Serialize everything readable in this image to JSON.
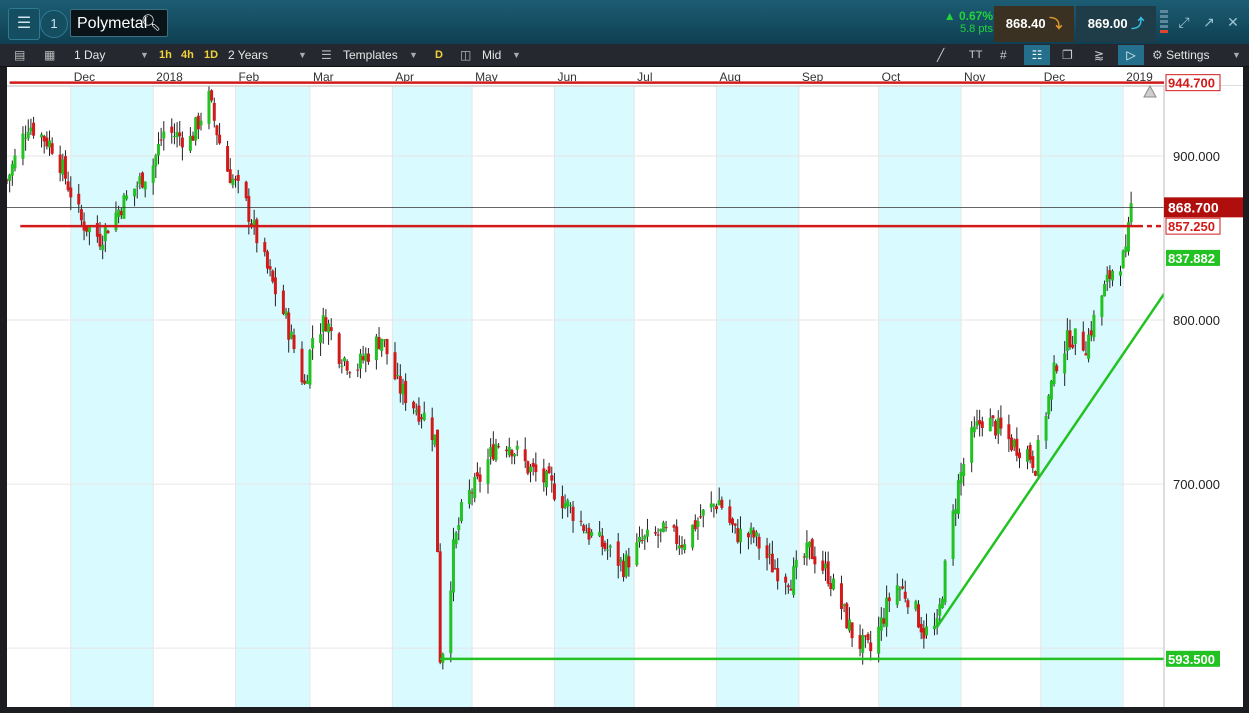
{
  "topbar": {
    "menu_icon": "hamburger-menu-icon",
    "info_label": "1",
    "symbol": "Polymetal",
    "change_pct": "▲ 0.67%",
    "change_pts": "5.8 pts",
    "sell_price": "868.40",
    "buy_price": "869.00"
  },
  "toolbar": {
    "interval": "1 Day",
    "quick_intervals": [
      "1h",
      "4h",
      "1D"
    ],
    "range": "2 Years",
    "templates": "Templates",
    "d_badge": "D",
    "price_type": "Mid",
    "tt_label": "TT",
    "settings": "Settings"
  },
  "colors": {
    "up": "#22c222",
    "down": "#d11b1b",
    "shade": "#d9fbff",
    "topbar": "#14536a"
  },
  "chart_data": {
    "type": "candlestick",
    "x_axis_labels": [
      "Dec",
      "2018",
      "Feb",
      "Mar",
      "Apr",
      "May",
      "Jun",
      "Jul",
      "Aug",
      "Sep",
      "Oct",
      "Nov",
      "Dec",
      "2019"
    ],
    "y_axis_ticks": [
      "900.000",
      "800.000",
      "700.000"
    ],
    "ylim": [
      565,
      970
    ],
    "grid": true,
    "horizontal_lines": [
      {
        "label": "944.700",
        "value": 944.7,
        "color": "#d11b1b"
      },
      {
        "label": "857.250",
        "value": 857.25,
        "color": "#d11b1b"
      },
      {
        "label": "593.500",
        "value": 593.5,
        "color": "#22c222"
      }
    ],
    "last_price": {
      "label": "868.700",
      "value": 868.7
    },
    "trendline": {
      "label": "837.882",
      "from": {
        "date": "2018-10-23",
        "value": 613
      },
      "to": {
        "date": "2019-01-04",
        "value": 837.882
      },
      "color": "#22c222"
    },
    "close_path": [
      [
        "2017-11-07",
        885
      ],
      [
        "2017-11-15",
        920
      ],
      [
        "2017-11-25",
        905
      ],
      [
        "2017-12-05",
        860
      ],
      [
        "2017-12-12",
        850
      ],
      [
        "2017-12-20",
        870
      ],
      [
        "2018-01-01",
        895
      ],
      [
        "2018-01-05",
        915
      ],
      [
        "2018-01-15",
        910
      ],
      [
        "2018-01-22",
        935
      ],
      [
        "2018-01-28",
        895
      ],
      [
        "2018-02-05",
        870
      ],
      [
        "2018-02-12",
        835
      ],
      [
        "2018-02-20",
        800
      ],
      [
        "2018-02-27",
        760
      ],
      [
        "2018-03-02",
        790
      ],
      [
        "2018-03-07",
        800
      ],
      [
        "2018-03-12",
        780
      ],
      [
        "2018-03-18",
        770
      ],
      [
        "2018-03-23",
        780
      ],
      [
        "2018-03-28",
        790
      ],
      [
        "2018-04-03",
        760
      ],
      [
        "2018-04-08",
        750
      ],
      [
        "2018-04-14",
        740
      ],
      [
        "2018-04-17",
        728
      ],
      [
        "2018-04-19",
        595
      ],
      [
        "2018-04-21",
        605
      ],
      [
        "2018-04-24",
        660
      ],
      [
        "2018-04-28",
        690
      ],
      [
        "2018-05-03",
        700
      ],
      [
        "2018-05-10",
        725
      ],
      [
        "2018-05-15",
        725
      ],
      [
        "2018-05-22",
        710
      ],
      [
        "2018-05-30",
        700
      ],
      [
        "2018-06-07",
        685
      ],
      [
        "2018-06-14",
        670
      ],
      [
        "2018-06-21",
        660
      ],
      [
        "2018-06-27",
        650
      ],
      [
        "2018-07-04",
        665
      ],
      [
        "2018-07-12",
        670
      ],
      [
        "2018-07-19",
        665
      ],
      [
        "2018-07-26",
        680
      ],
      [
        "2018-08-02",
        690
      ],
      [
        "2018-08-08",
        670
      ],
      [
        "2018-08-15",
        668
      ],
      [
        "2018-08-22",
        650
      ],
      [
        "2018-08-29",
        642
      ],
      [
        "2018-09-05",
        660
      ],
      [
        "2018-09-12",
        645
      ],
      [
        "2018-09-17",
        625
      ],
      [
        "2018-09-22",
        605
      ],
      [
        "2018-09-28",
        598
      ],
      [
        "2018-10-03",
        620
      ],
      [
        "2018-10-07",
        640
      ],
      [
        "2018-10-13",
        630
      ],
      [
        "2018-10-18",
        610
      ],
      [
        "2018-10-23",
        612
      ],
      [
        "2018-10-27",
        660
      ],
      [
        "2018-10-31",
        700
      ],
      [
        "2018-11-04",
        725
      ],
      [
        "2018-11-09",
        740
      ],
      [
        "2018-11-14",
        735
      ],
      [
        "2018-11-20",
        725
      ],
      [
        "2018-11-26",
        720
      ],
      [
        "2018-11-29",
        712
      ],
      [
        "2018-12-03",
        745
      ],
      [
        "2018-12-07",
        775
      ],
      [
        "2018-12-12",
        790
      ],
      [
        "2018-12-18",
        785
      ],
      [
        "2018-12-24",
        815
      ],
      [
        "2018-12-29",
        835
      ],
      [
        "2019-01-02",
        838
      ],
      [
        "2019-01-04",
        869
      ]
    ]
  }
}
